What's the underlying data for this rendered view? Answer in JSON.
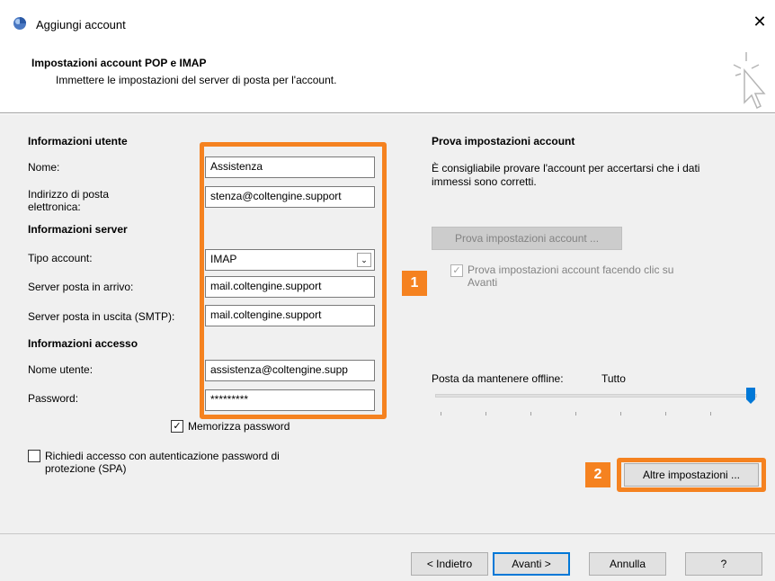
{
  "window": {
    "title": "Aggiungi account",
    "close_glyph": "✕"
  },
  "header": {
    "title": "Impostazioni account POP e IMAP",
    "subtitle": "Immettere le impostazioni del server di posta per l'account."
  },
  "user_info": {
    "heading": "Informazioni utente",
    "name_label": "Nome:",
    "name_value": "Assistenza",
    "email_label_line1": "Indirizzo di posta",
    "email_label_line2": "elettronica:",
    "email_value": "stenza@coltengine.support"
  },
  "server_info": {
    "heading": "Informazioni server",
    "account_type_label": "Tipo account:",
    "account_type_value": "IMAP",
    "incoming_label": "Server posta in arrivo:",
    "incoming_value": "mail.coltengine.support",
    "outgoing_label": "Server posta in uscita (SMTP):",
    "outgoing_value": "mail.coltengine.support"
  },
  "login_info": {
    "heading": "Informazioni accesso",
    "username_label": "Nome utente:",
    "username_value": "assistenza@coltengine.supp",
    "password_label": "Password:",
    "password_value": "*********",
    "remember_label": "Memorizza password",
    "remember_checked": true,
    "spa_label_line1": "Richiedi accesso con autenticazione password di",
    "spa_label_line2": "protezione (SPA)",
    "spa_checked": false
  },
  "test": {
    "heading": "Prova impostazioni account",
    "description_line1": "È consigliabile provare l'account per accertarsi che i dati",
    "description_line2": "immessi sono corretti.",
    "test_button": "Prova impostazioni account ...",
    "auto_test_label_line1": "Prova impostazioni account facendo clic su",
    "auto_test_label_line2": "Avanti",
    "auto_test_checked": true
  },
  "offline": {
    "label": "Posta da mantenere offline:",
    "value": "Tutto",
    "slider_level": 1.0
  },
  "more_settings_button": "Altre impostazioni ...",
  "badges": {
    "one": "1",
    "two": "2"
  },
  "footer": {
    "back": "< Indietro",
    "next": "Avanti >",
    "cancel": "Annulla",
    "help": "?"
  },
  "colors": {
    "accent": "#f58220",
    "primary": "#0078d7"
  }
}
